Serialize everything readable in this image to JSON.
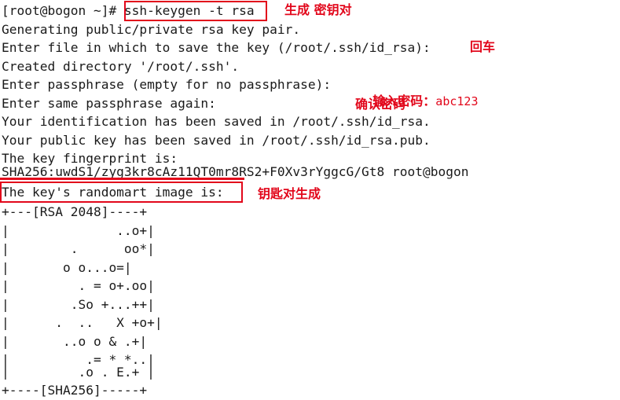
{
  "window": {
    "kind": "terminal",
    "background": "#ffffff",
    "foreground": "#1a1a1a",
    "annotation_color": "#e2071b"
  },
  "terminal": {
    "lines": [
      "[root@bogon ~]# ssh-keygen -t rsa",
      "Generating public/private rsa key pair.",
      "Enter file in which to save the key (/root/.ssh/id_rsa):",
      "Created directory '/root/.ssh'.",
      "Enter passphrase (empty for no passphrase):",
      "Enter same passphrase again:",
      "Your identification has been saved in /root/.ssh/id_rsa.",
      "Your public key has been saved in /root/.ssh/id_rsa.pub.",
      "The key fingerprint is:",
      "SHA256:uwdS1/zyg3kr8cAz11QT0mr8RS2+F0Xv3rYggcG/Gt8 root@bogon",
      "The key's randomart image is:"
    ],
    "prompt": "[root@bogon ~]#",
    "command": "ssh-keygen -t rsa",
    "fingerprint": "SHA256:uwdS1/zyg3kr8cAz11QT0mr8RS2+F0Xv3rYggcG/Gt8 root@bogon"
  },
  "randomart": {
    "top_border": "+---[RSA 2048]----+",
    "bottom_border": "+----[SHA256]-----+",
    "rows": [
      "|           ..o+|",
      "|     .      oo*|",
      "|      o o...o=|",
      "|      . = o+.oo|",
      "|     .So +...++|",
      "|    .  ..   X +o+|",
      "|    ..o o & .+|",
      "|       .= * *..|",
      "|      .o . E.+ |"
    ],
    "rows_raw": [
      "|              ..o+|",
      "|        .      oo*|",
      "|       o o...o=|",
      "|         . = o+.oo|",
      "|        .So +...++|",
      "|      .  ..   X +o+|",
      "|       ..o o & .+|",
      "|          .= * *..|",
      "|         .o . E.+ |"
    ]
  },
  "annotations": [
    {
      "id": "anno-generate-keypair",
      "text": "生成 密钥对"
    },
    {
      "id": "anno-enter-key",
      "text": "回车"
    },
    {
      "id": "anno-input-password",
      "text_cn": "输入密码：",
      "text_value": "abc123"
    },
    {
      "id": "anno-confirm-password",
      "text": "确认密码"
    },
    {
      "id": "anno-keypair-generated",
      "text": "钥匙对生成"
    }
  ],
  "highlights": {
    "command_box": "ssh-keygen -t rsa",
    "fingerprint_underline": "SHA256 fingerprint",
    "randomart_label_box": "The key's randomart image is:"
  }
}
